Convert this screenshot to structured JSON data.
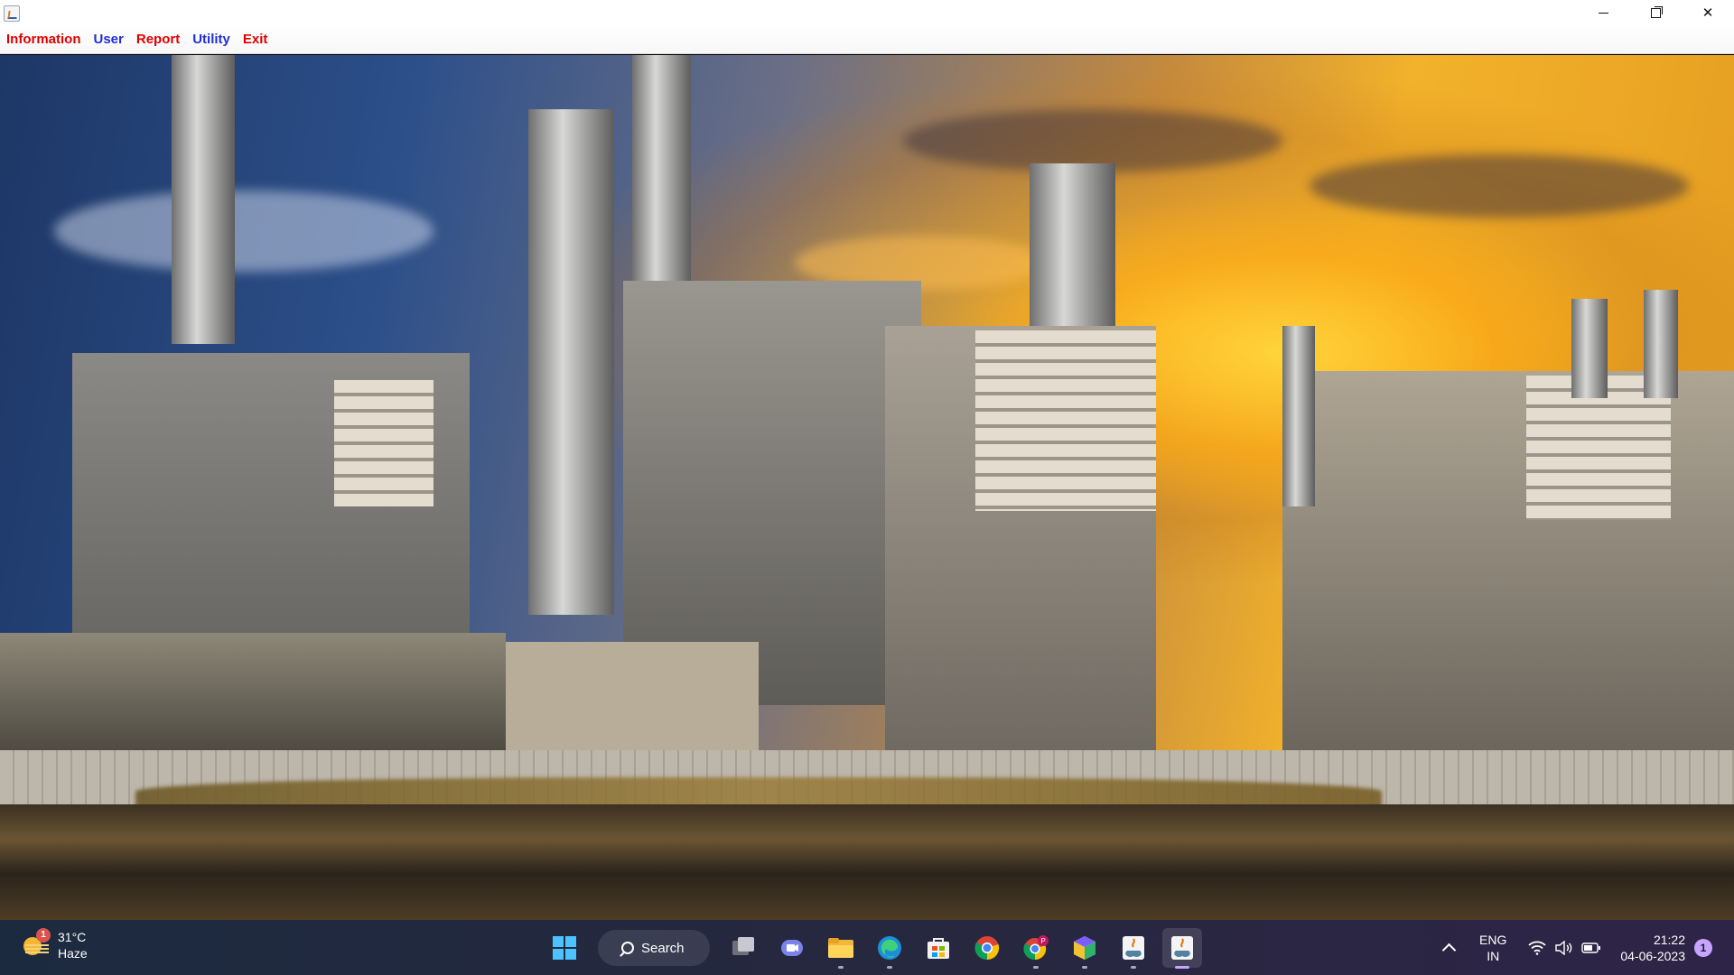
{
  "window": {
    "controls": {
      "minimize": "minimize-icon",
      "restore": "restore-icon",
      "close": "close-icon"
    }
  },
  "menu": {
    "items": [
      {
        "label": "Information",
        "color": "#e00000"
      },
      {
        "label": "User",
        "color": "#1f2fd6"
      },
      {
        "label": "Report",
        "color": "#e00000"
      },
      {
        "label": "Utility",
        "color": "#1f2fd6"
      },
      {
        "label": "Exit",
        "color": "#e00000"
      }
    ]
  },
  "taskbar": {
    "weather": {
      "temp": "31°C",
      "condition": "Haze",
      "badge": "1"
    },
    "search_label": "Search",
    "apps": [
      {
        "icon": "start-windows-icon"
      },
      {
        "icon": "task-view-icon"
      },
      {
        "icon": "teams-chat-icon"
      },
      {
        "icon": "file-explorer-icon"
      },
      {
        "icon": "edge-browser-icon"
      },
      {
        "icon": "microsoft-store-icon"
      },
      {
        "icon": "chrome-icon"
      },
      {
        "icon": "chrome-profile-icon"
      },
      {
        "icon": "cube-app-icon"
      },
      {
        "icon": "java-app-icon"
      },
      {
        "icon": "java-app-active-icon"
      }
    ],
    "tray": {
      "lang_line1": "ENG",
      "lang_line2": "IN",
      "time": "21:22",
      "date": "04-06-2023",
      "notification_count": "1"
    }
  }
}
